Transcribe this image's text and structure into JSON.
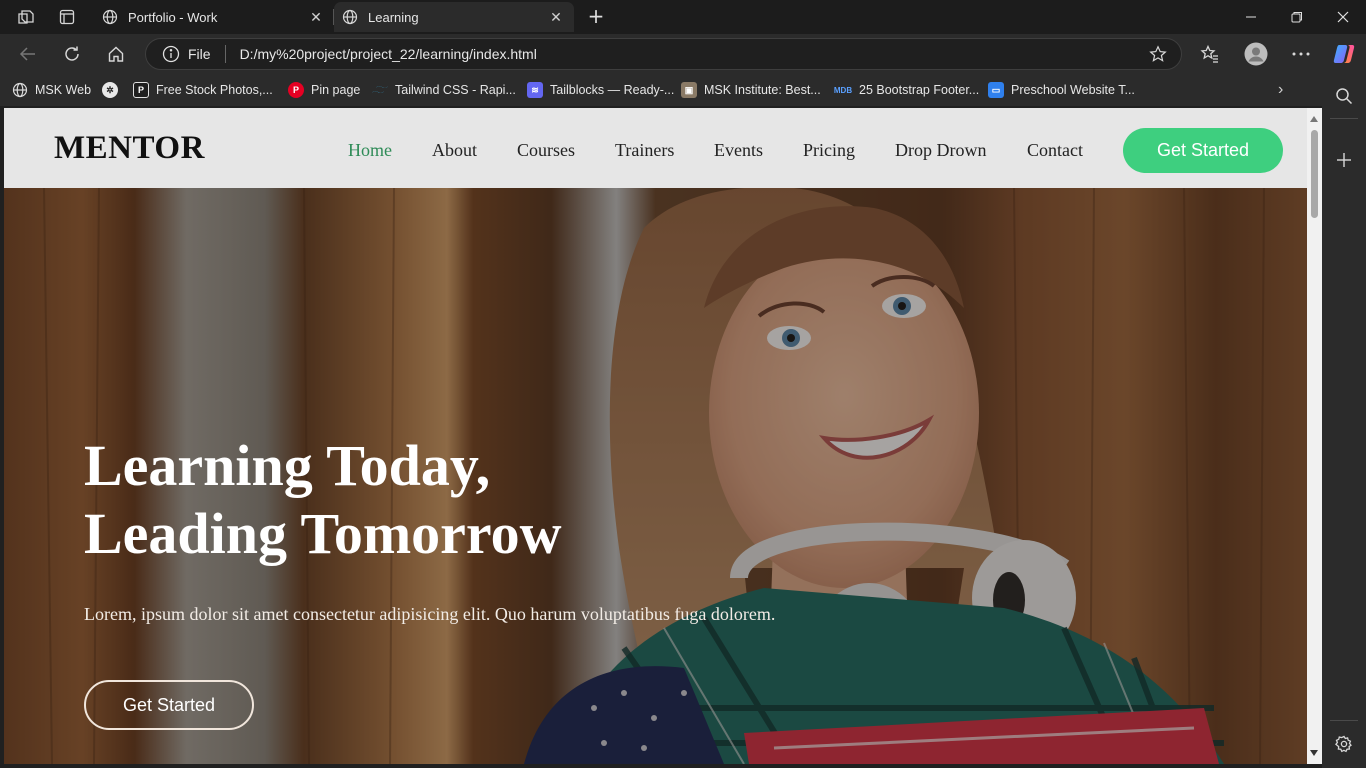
{
  "browser": {
    "tabs": [
      {
        "title": "Portfolio - Work",
        "active": false
      },
      {
        "title": "Learning",
        "active": true
      }
    ],
    "address": {
      "scheme_label": "File",
      "url": "D:/my%20project/project_22/learning/index.html"
    },
    "bookmarks": [
      {
        "label": "MSK Web",
        "icon": "globe-icon"
      },
      {
        "label": "",
        "icon": "chatgpt-icon"
      },
      {
        "label": "Free Stock Photos,...",
        "icon": "pexels-icon"
      },
      {
        "label": "Pin page",
        "icon": "pinterest-icon"
      },
      {
        "label": "Tailwind CSS - Rapi...",
        "icon": "tailwind-icon"
      },
      {
        "label": "Tailblocks — Ready-...",
        "icon": "tailblocks-icon"
      },
      {
        "label": "MSK Institute: Best...",
        "icon": "msk-institute-icon"
      },
      {
        "label": "25 Bootstrap Footer...",
        "icon": "mdb-icon"
      },
      {
        "label": "Preschool Website T...",
        "icon": "preschool-icon"
      }
    ]
  },
  "site": {
    "logo": "MENTOR",
    "menu": [
      "Home",
      "About",
      "Courses",
      "Trainers",
      "Events",
      "Pricing",
      "Drop Drown",
      "Contact"
    ],
    "active_menu": "Home",
    "header_cta": "Get Started",
    "hero": {
      "title_line1": "Learning Today,",
      "title_line2": "Leading Tomorrow",
      "subtitle": "Lorem, ipsum dolor sit amet consectetur adipisicing elit. Quo harum voluptatibus fuga dolorem.",
      "cta": "Get Started"
    }
  },
  "colors": {
    "accent_green": "#3ecf7f",
    "active_menu": "#2e8b57",
    "header_bg": "#e6e6e6",
    "browser_chrome": "#2b2b2b"
  }
}
